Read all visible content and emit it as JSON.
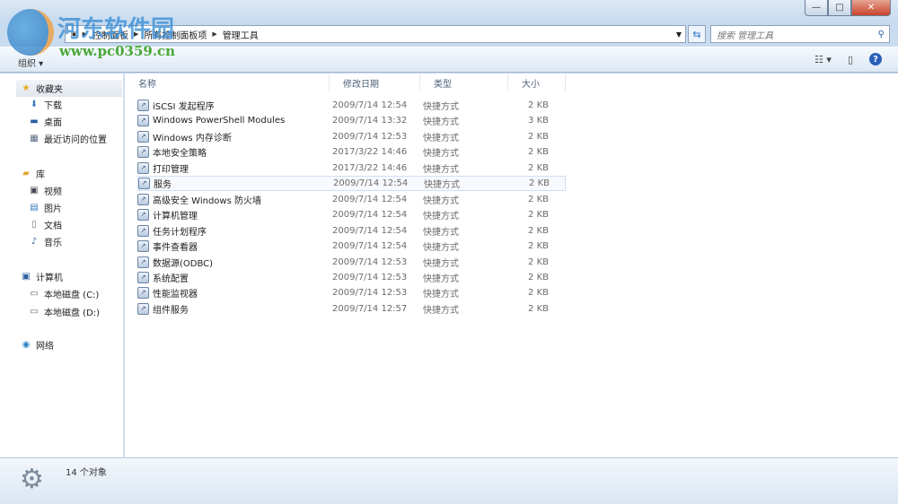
{
  "window": {
    "minimize": "—",
    "maximize": "□",
    "close": "✕"
  },
  "address": {
    "segments": [
      "控制面板",
      "所有控制面板项",
      "管理工具"
    ]
  },
  "search": {
    "placeholder": "搜索 管理工具",
    "icon": "search-icon"
  },
  "toolbar": {
    "organize": "组织 ▾",
    "view": "☷ ▾",
    "pane": "▯",
    "help": "?"
  },
  "sidebar": {
    "favorites": {
      "label": "收藏夹",
      "items": [
        "下载",
        "桌面",
        "最近访问的位置"
      ]
    },
    "libraries": {
      "label": "库",
      "items": [
        "视频",
        "图片",
        "文档",
        "音乐"
      ]
    },
    "computer": {
      "label": "计算机",
      "items": [
        "本地磁盘 (C:)",
        "本地磁盘 (D:)"
      ]
    },
    "network": {
      "label": "网络"
    }
  },
  "columns": {
    "name": "名称",
    "date": "修改日期",
    "type": "类型",
    "size": "大小"
  },
  "files": [
    {
      "name": "iSCSI 发起程序",
      "date": "2009/7/14 12:54",
      "type": "快捷方式",
      "size": "2 KB"
    },
    {
      "name": "Windows PowerShell Modules",
      "date": "2009/7/14 13:32",
      "type": "快捷方式",
      "size": "3 KB"
    },
    {
      "name": "Windows 内存诊断",
      "date": "2009/7/14 12:53",
      "type": "快捷方式",
      "size": "2 KB"
    },
    {
      "name": "本地安全策略",
      "date": "2017/3/22 14:46",
      "type": "快捷方式",
      "size": "2 KB"
    },
    {
      "name": "打印管理",
      "date": "2017/3/22 14:46",
      "type": "快捷方式",
      "size": "2 KB"
    },
    {
      "name": "服务",
      "date": "2009/7/14 12:54",
      "type": "快捷方式",
      "size": "2 KB"
    },
    {
      "name": "高级安全 Windows 防火墙",
      "date": "2009/7/14 12:54",
      "type": "快捷方式",
      "size": "2 KB"
    },
    {
      "name": "计算机管理",
      "date": "2009/7/14 12:54",
      "type": "快捷方式",
      "size": "2 KB"
    },
    {
      "name": "任务计划程序",
      "date": "2009/7/14 12:54",
      "type": "快捷方式",
      "size": "2 KB"
    },
    {
      "name": "事件查看器",
      "date": "2009/7/14 12:54",
      "type": "快捷方式",
      "size": "2 KB"
    },
    {
      "name": "数据源(ODBC)",
      "date": "2009/7/14 12:53",
      "type": "快捷方式",
      "size": "2 KB"
    },
    {
      "name": "系统配置",
      "date": "2009/7/14 12:53",
      "type": "快捷方式",
      "size": "2 KB"
    },
    {
      "name": "性能监视器",
      "date": "2009/7/14 12:53",
      "type": "快捷方式",
      "size": "2 KB"
    },
    {
      "name": "组件服务",
      "date": "2009/7/14 12:57",
      "type": "快捷方式",
      "size": "2 KB"
    }
  ],
  "status": {
    "count": "14 个对象"
  },
  "watermark": {
    "text": "河东软件园",
    "url": "www.pc0359.cn"
  }
}
